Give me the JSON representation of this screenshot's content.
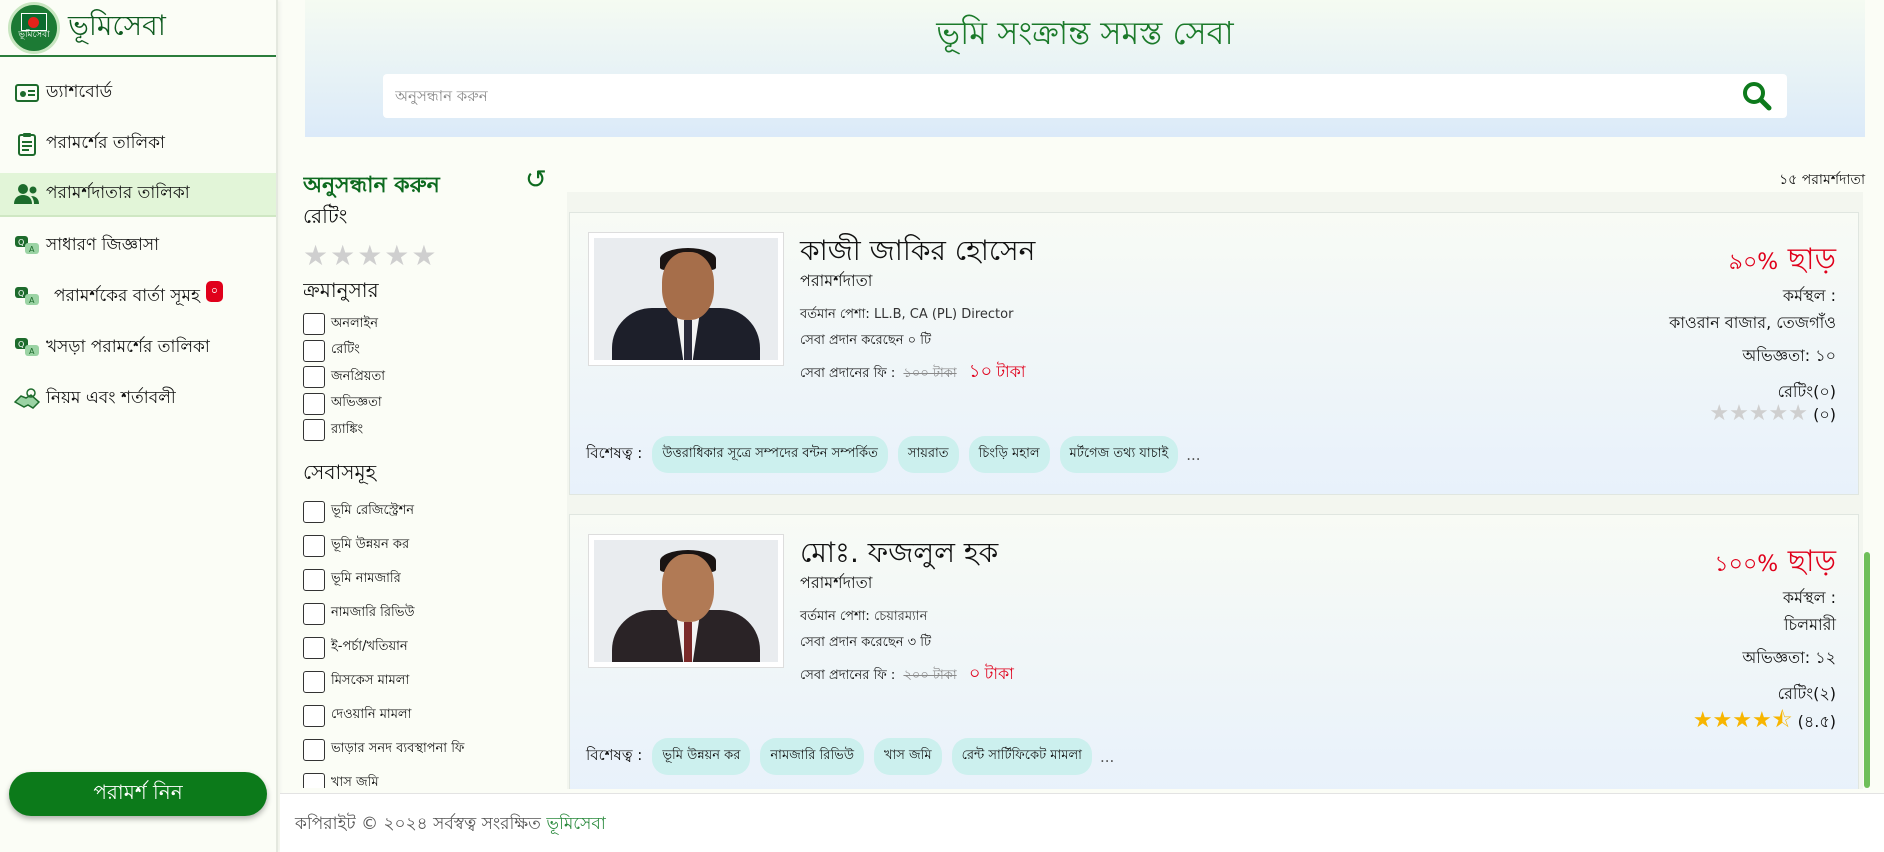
{
  "brand": {
    "name": "ভূমিসেবা",
    "logo_text": "ভূমিসেবা"
  },
  "sidebar": {
    "items": [
      {
        "label": "ড্যাশবোর্ড",
        "icon": "dashboard-icon"
      },
      {
        "label": "পরামর্শের তালিকা",
        "icon": "clipboard-icon"
      },
      {
        "label": "পরামর্শদাতার তালিকা",
        "icon": "users-icon",
        "active": true
      },
      {
        "label": "সাধারণ জিজ্ঞাসা",
        "icon": "chat-bubbles-icon"
      },
      {
        "label": "পরামর্শকের বার্তা সূমহ",
        "icon": "chat-bubbles-icon",
        "badge": "০"
      },
      {
        "label": "খসড়া পরামর্শের তালিকা",
        "icon": "chat-bubbles-icon"
      },
      {
        "label": "নিয়ম এবং শর্তাবলী",
        "icon": "handshake-icon"
      }
    ],
    "cta": "পরামর্শ নিন"
  },
  "header": {
    "title": "ভূমি সংক্রান্ত সমস্ত সেবা",
    "search_placeholder": "অনুসন্ধান করুন"
  },
  "filters": {
    "title": "অনুসন্ধান করুন",
    "reset_symbol": "↺",
    "rating_heading": "রেটিং",
    "rating_stars": "★★★★★",
    "sort_heading": "ক্রমানুসার",
    "sort_options": [
      "অনলাইন",
      "রেটিং",
      "জনপ্রিয়তা",
      "অভিজ্ঞতা",
      "র‍্যাঙ্কিং"
    ],
    "services_heading": "সেবাসমূহ",
    "service_options": [
      "ভূমি রেজিস্ট্রেশন",
      "ভূমি উন্নয়ন কর",
      "ভূমি নামজারি",
      "নামজারি রিভিউ",
      "ই-পর্চা/খতিয়ান",
      "মিসকেস মামলা",
      "দেওয়ানি মামলা",
      "ভাড়ার সনদ ব্যবস্থাপনা ফি",
      "খাস জমি"
    ]
  },
  "results": {
    "count": "১৫ পরামর্শদাতা",
    "cards": [
      {
        "name": "কাজী জাকির হোসেন",
        "role": "পরামর্শদাতা",
        "profession_label": "বর্তমান পেশা:",
        "profession": "LL.B, CA (PL) Director",
        "served": "সেবা প্রদান করেছেন ০ টি",
        "fee_label": "সেবা প্রদানের ফি :",
        "old_fee": "১০০ টাকা",
        "new_fee_num": "১০",
        "new_fee_unit": "টাকা",
        "discount_pct": "৯০%",
        "discount_word": "ছাড়",
        "workplace_label": "কর্মস্থল :",
        "workplace": "কাওরান বাজার, তেজগাঁও",
        "experience": "অভিজ্ঞতা: ১০",
        "rating_label": "রেটিং(০)",
        "rating_stars_filled": "",
        "rating_stars_empty": "★★★★★",
        "rating_value": "(০)",
        "tags_label": "বিশেষত্ব :",
        "tags": [
          "উত্তরাধিকার সূত্রে সম্পদের বন্টন সম্পর্কিত",
          "সায়রাত",
          "চিংড়ি মহাল",
          "মর্টগেজ তথ্য যাচাই"
        ],
        "more": "..."
      },
      {
        "name": "মোঃ. ফজলুল হক",
        "role": "পরামর্শদাতা",
        "profession_label": "বর্তমান পেশা:",
        "profession": "চেয়ারম্যান",
        "served": "সেবা প্রদান করেছেন ৩ টি",
        "fee_label": "সেবা প্রদানের ফি :",
        "old_fee": "২০০ টাকা",
        "new_fee_num": "০",
        "new_fee_unit": "টাকা",
        "discount_pct": "১০০%",
        "discount_word": "ছাড়",
        "workplace_label": "কর্মস্থল :",
        "workplace": "চিলমারী",
        "experience": "অভিজ্ঞতা: ১২",
        "rating_label": "রেটিং(২)",
        "rating_stars_filled": "★★★★",
        "rating_stars_empty": "⯪",
        "rating_value": "(৪.৫)",
        "tags_label": "বিশেষত্ব :",
        "tags": [
          "ভূমি উন্নয়ন কর",
          "নামজারি রিভিউ",
          "খাস জমি",
          "রেন্ট সার্টিফিকেট মামলা"
        ],
        "more": "..."
      }
    ]
  },
  "footer": {
    "text": "কপিরাইট © ২০২৪ সর্বস্বত্ব সংরক্ষিত",
    "brand": "ভূমিসেবা"
  },
  "colors": {
    "brand_green": "#0c7a1a",
    "accent_red": "#e0001b",
    "tag_bg": "#ccf0ee",
    "star_yellow": "#f7b500"
  }
}
